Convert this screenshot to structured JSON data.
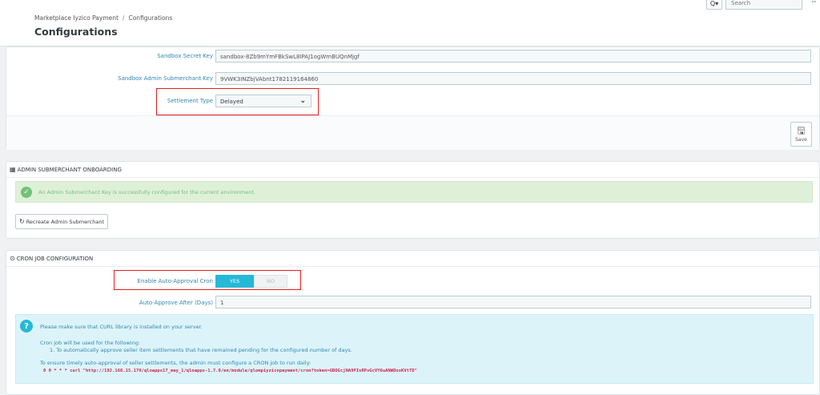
{
  "header": {
    "breadcrumb": [
      "Marketplace Iyzico Payment",
      "Configurations"
    ],
    "breadcrumb_separator": "/",
    "title": "Configurations",
    "search_placeholder": "Search",
    "search_icon": "Q▾",
    "more_icon": "···"
  },
  "settings_panel": {
    "fields": [
      {
        "label": "Sandbox Secret Key",
        "value": "sandbox-8Zb9mYmFBkSwL8IPAJ1ogWmBUQnMjgf"
      },
      {
        "label": "Sandbox Admin Submerchant Key",
        "value": "9VWK3INZbjVAbnt1782119164860"
      }
    ],
    "settlement": {
      "label": "Settlement Type",
      "value": "Delayed"
    },
    "save_label": "Save"
  },
  "submerchant_panel": {
    "heading": "ADMIN SUBMERCHANT ONBOARDING",
    "success_message": "An Admin Submerchant Key is successfully configured for the current environment.",
    "recreate_button": "Recreate Admin Submerchant"
  },
  "cron_panel": {
    "heading": "CRON JOB CONFIGURATION",
    "auto_approval": {
      "label": "Enable Auto-Approval Cron",
      "yes": "YES",
      "no": "NO",
      "selected": "YES"
    },
    "auto_approve_days": {
      "label": "Auto-Approve After (Days)",
      "value": "1"
    },
    "info": {
      "line1": "Please make sure that CURL library is installed on your server.",
      "line2": "Cron job will be used for the following:",
      "line3": "1. To automatically approve seller item settlements that have remained pending for the configured number of days.",
      "line4": "To ensure timely auto-approval of seller settlements, the admin must configure a CRON job to run daily:",
      "command": "0 0 * * * curl \"http://192.168.15.179/qloapps17_may_1/qloapps-1.7.0/en/module/qlompiyzicopayment/cron?token=GBOGcjNA9PIsRPvGcVY6uANWDosKVtTD\""
    }
  },
  "colors": {
    "accent": "#25b9d7",
    "label": "#3586ae",
    "highlight": "#e41e1e",
    "success": "#72c279",
    "code": "#c7254e"
  }
}
